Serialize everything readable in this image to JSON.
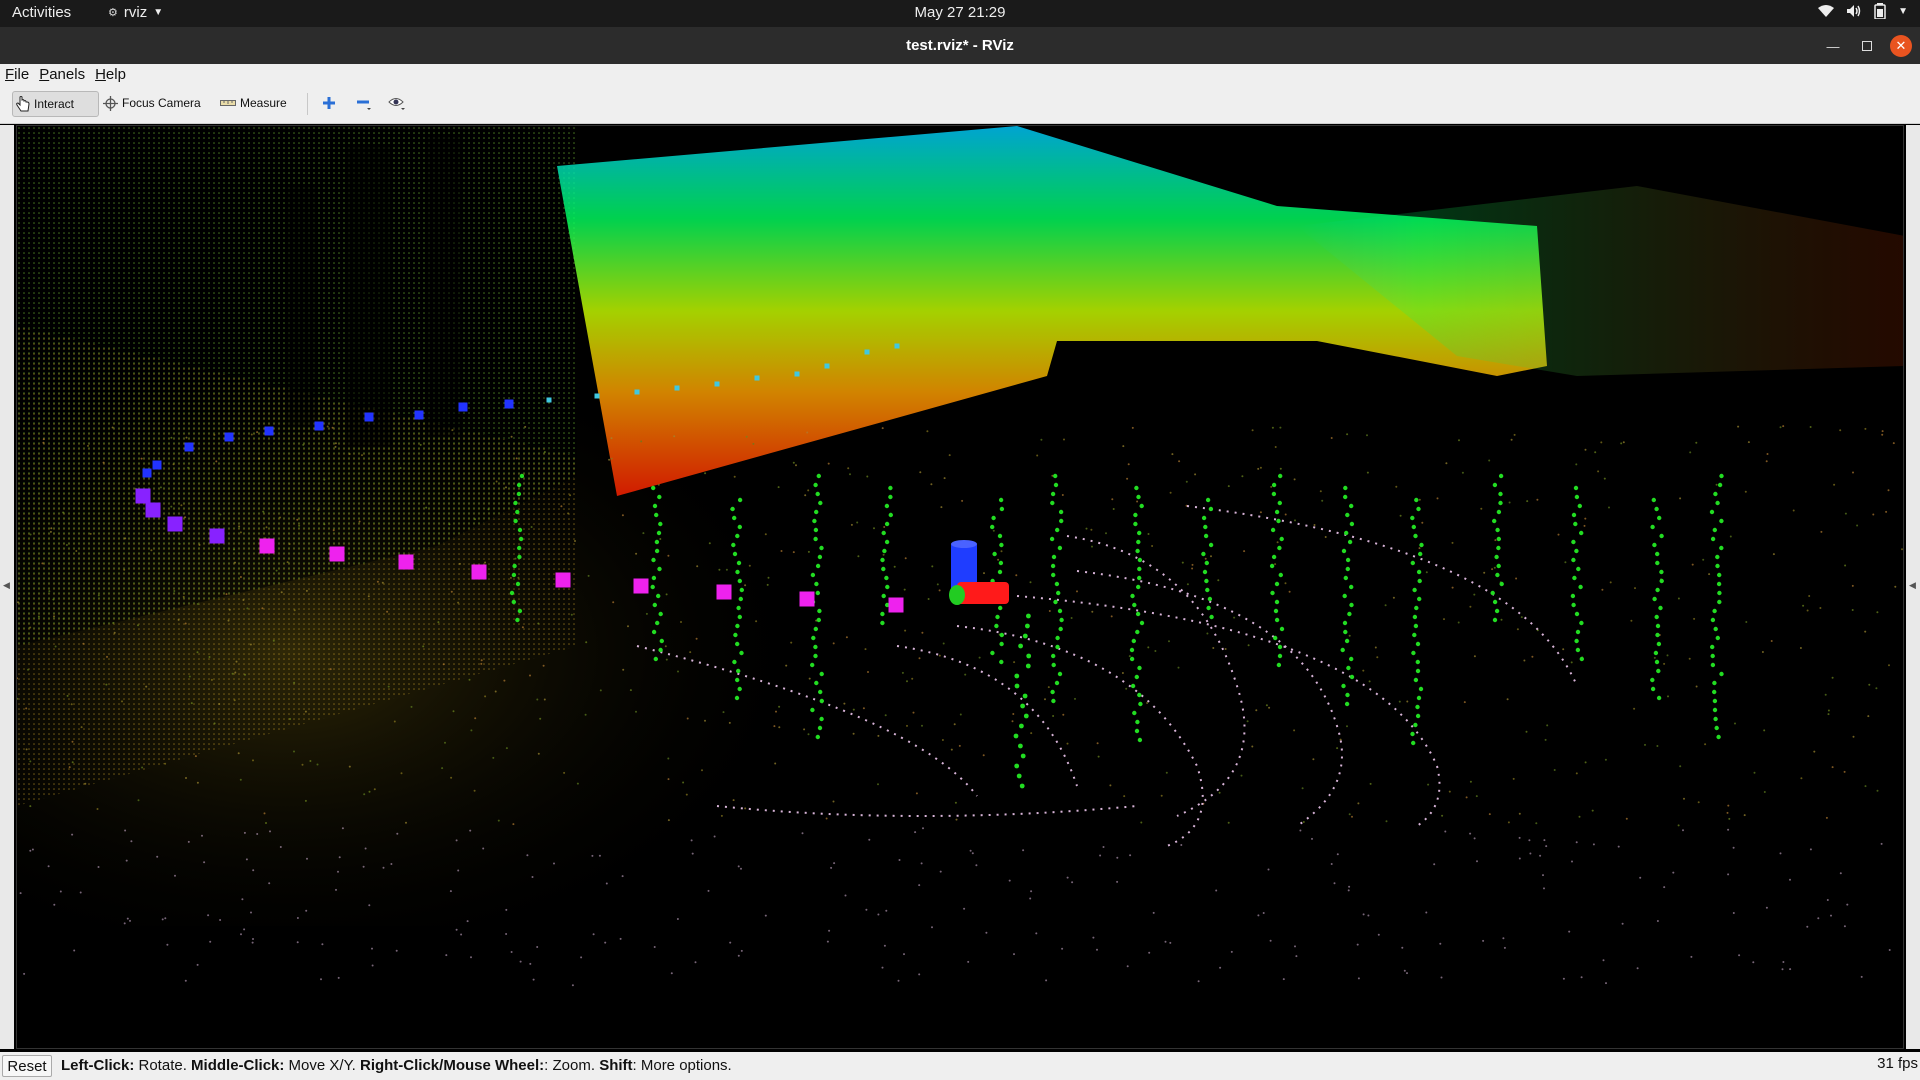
{
  "topbar": {
    "activities": "Activities",
    "app_name": "rviz",
    "clock": "May 27  21:29",
    "tray_icons": [
      "wifi-icon",
      "volume-icon",
      "battery-icon",
      "system-menu-caret-icon"
    ]
  },
  "window": {
    "title": "test.rviz* - RViz",
    "buttons": [
      "minimize",
      "maximize",
      "close"
    ]
  },
  "menubar": {
    "items": [
      {
        "mnemonic": "F",
        "rest": "ile"
      },
      {
        "mnemonic": "P",
        "rest": "anels"
      },
      {
        "mnemonic": "H",
        "rest": "elp"
      }
    ]
  },
  "toolbar": {
    "interact": "Interact",
    "focus_camera": "Focus Camera",
    "measure": "Measure",
    "extra_icons": [
      "add-tool-icon",
      "remove-tool-icon",
      "view-options-icon"
    ]
  },
  "viewport": {
    "background": "#000000",
    "pose_path_colors": [
      "#2233ff",
      "#8822ff",
      "#ee22ee"
    ],
    "feature_point_color": "#22dd22",
    "axes_colors": {
      "x": "#ff1a1a",
      "y": "#22cc22",
      "z": "#1f3dff"
    }
  },
  "statusbar": {
    "reset": "Reset",
    "help": [
      {
        "key": "Left-Click:",
        "desc": " Rotate. "
      },
      {
        "key": "Middle-Click:",
        "desc": " Move X/Y. "
      },
      {
        "key": "Right-Click/Mouse Wheel:",
        "desc": ": Zoom. "
      },
      {
        "key": "Shift",
        "desc": ": More options."
      }
    ],
    "fps": "31 fps"
  }
}
